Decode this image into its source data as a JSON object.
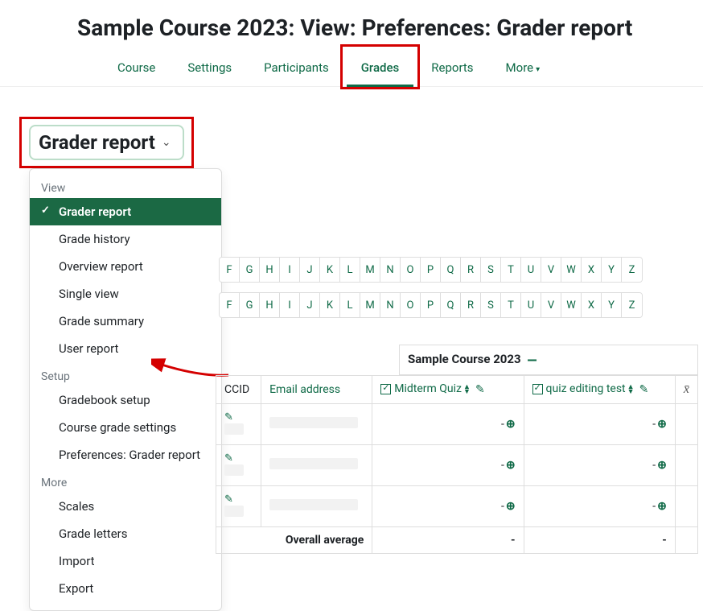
{
  "page_title": "Sample Course 2023: View: Preferences: Grader report",
  "nav": {
    "tabs": [
      {
        "label": "Course",
        "active": false
      },
      {
        "label": "Settings",
        "active": false
      },
      {
        "label": "Participants",
        "active": false
      },
      {
        "label": "Grades",
        "active": true
      },
      {
        "label": "Reports",
        "active": false
      }
    ],
    "more_label": "More"
  },
  "dropdown": {
    "toggle_label": "Grader report",
    "groups": [
      {
        "label": "View",
        "items": [
          {
            "label": "Grader report",
            "selected": true,
            "pointed": false
          },
          {
            "label": "Grade history",
            "selected": false,
            "pointed": false
          },
          {
            "label": "Overview report",
            "selected": false,
            "pointed": false
          },
          {
            "label": "Single view",
            "selected": false,
            "pointed": false
          },
          {
            "label": "Grade summary",
            "selected": false,
            "pointed": false
          },
          {
            "label": "User report",
            "selected": false,
            "pointed": false
          }
        ]
      },
      {
        "label": "Setup",
        "items": [
          {
            "label": "Gradebook setup",
            "selected": false,
            "pointed": true
          },
          {
            "label": "Course grade settings",
            "selected": false,
            "pointed": false
          },
          {
            "label": "Preferences: Grader report",
            "selected": false,
            "pointed": false
          }
        ]
      },
      {
        "label": "More",
        "items": [
          {
            "label": "Scales",
            "selected": false,
            "pointed": false
          },
          {
            "label": "Grade letters",
            "selected": false,
            "pointed": false
          },
          {
            "label": "Import",
            "selected": false,
            "pointed": false
          },
          {
            "label": "Export",
            "selected": false,
            "pointed": false
          }
        ]
      }
    ]
  },
  "alpha": {
    "letters": [
      "F",
      "G",
      "H",
      "I",
      "J",
      "K",
      "L",
      "M",
      "N",
      "O",
      "P",
      "Q",
      "R",
      "S",
      "T",
      "U",
      "V",
      "W",
      "X",
      "Y",
      "Z"
    ]
  },
  "grades": {
    "course_name": "Sample Course 2023",
    "columns": {
      "ccid": "CCID",
      "email": "Email address",
      "items": [
        {
          "label": "Midterm Quiz"
        },
        {
          "label": "quiz editing test"
        }
      ]
    },
    "overall_label": "Overall average",
    "rows": [
      {
        "values": [
          "-",
          "-"
        ]
      },
      {
        "values": [
          "-",
          "-"
        ]
      },
      {
        "values": [
          "-",
          "-"
        ]
      }
    ],
    "overall_values": [
      "-",
      "-"
    ]
  },
  "annotations": {
    "highlight_grades_tab": true,
    "highlight_dropdown": true,
    "arrow_to": "Gradebook setup"
  }
}
